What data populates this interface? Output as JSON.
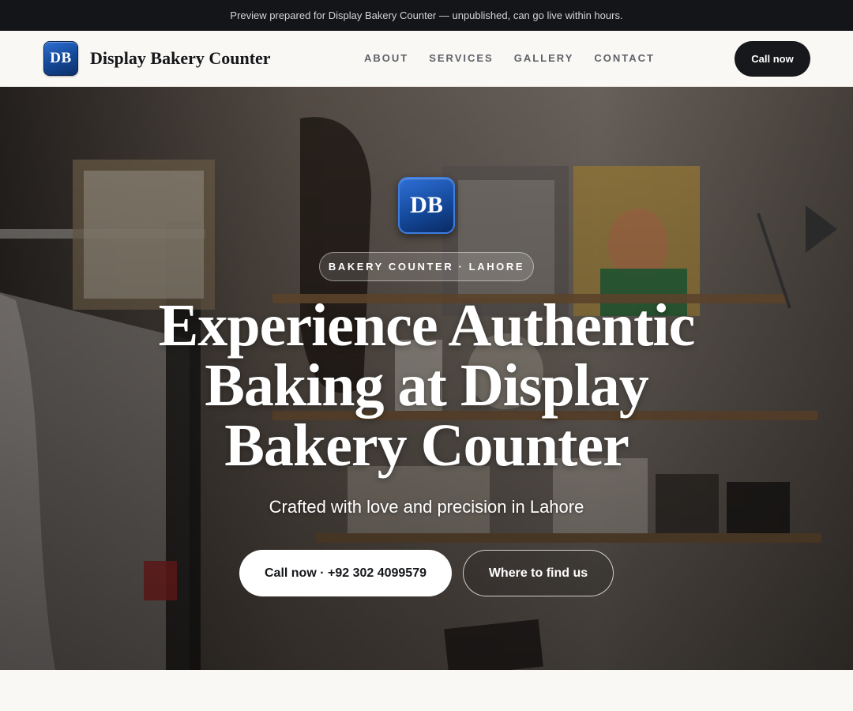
{
  "banner": {
    "text": "Preview prepared for Display Bakery Counter — unpublished, can go live within hours."
  },
  "header": {
    "logo_text": "DB",
    "brand_name": "Display Bakery Counter",
    "nav": [
      {
        "label": "ABOUT"
      },
      {
        "label": "SERVICES"
      },
      {
        "label": "GALLERY"
      },
      {
        "label": "CONTACT"
      }
    ],
    "cta_label": "Call now"
  },
  "hero": {
    "logo_text": "DB",
    "tag": "BAKERY COUNTER · LAHORE",
    "title": "Experience Authentic Baking at Display Bakery Counter",
    "subtitle": "Crafted with love and precision in Lahore",
    "primary_button": "Call now · +92 302 4099579",
    "secondary_button": "Where to find us"
  },
  "colors": {
    "banner_bg": "#141519",
    "page_bg": "#f9f8f4",
    "dark_button": "#17181c",
    "logo_blue": "#154a9a"
  }
}
